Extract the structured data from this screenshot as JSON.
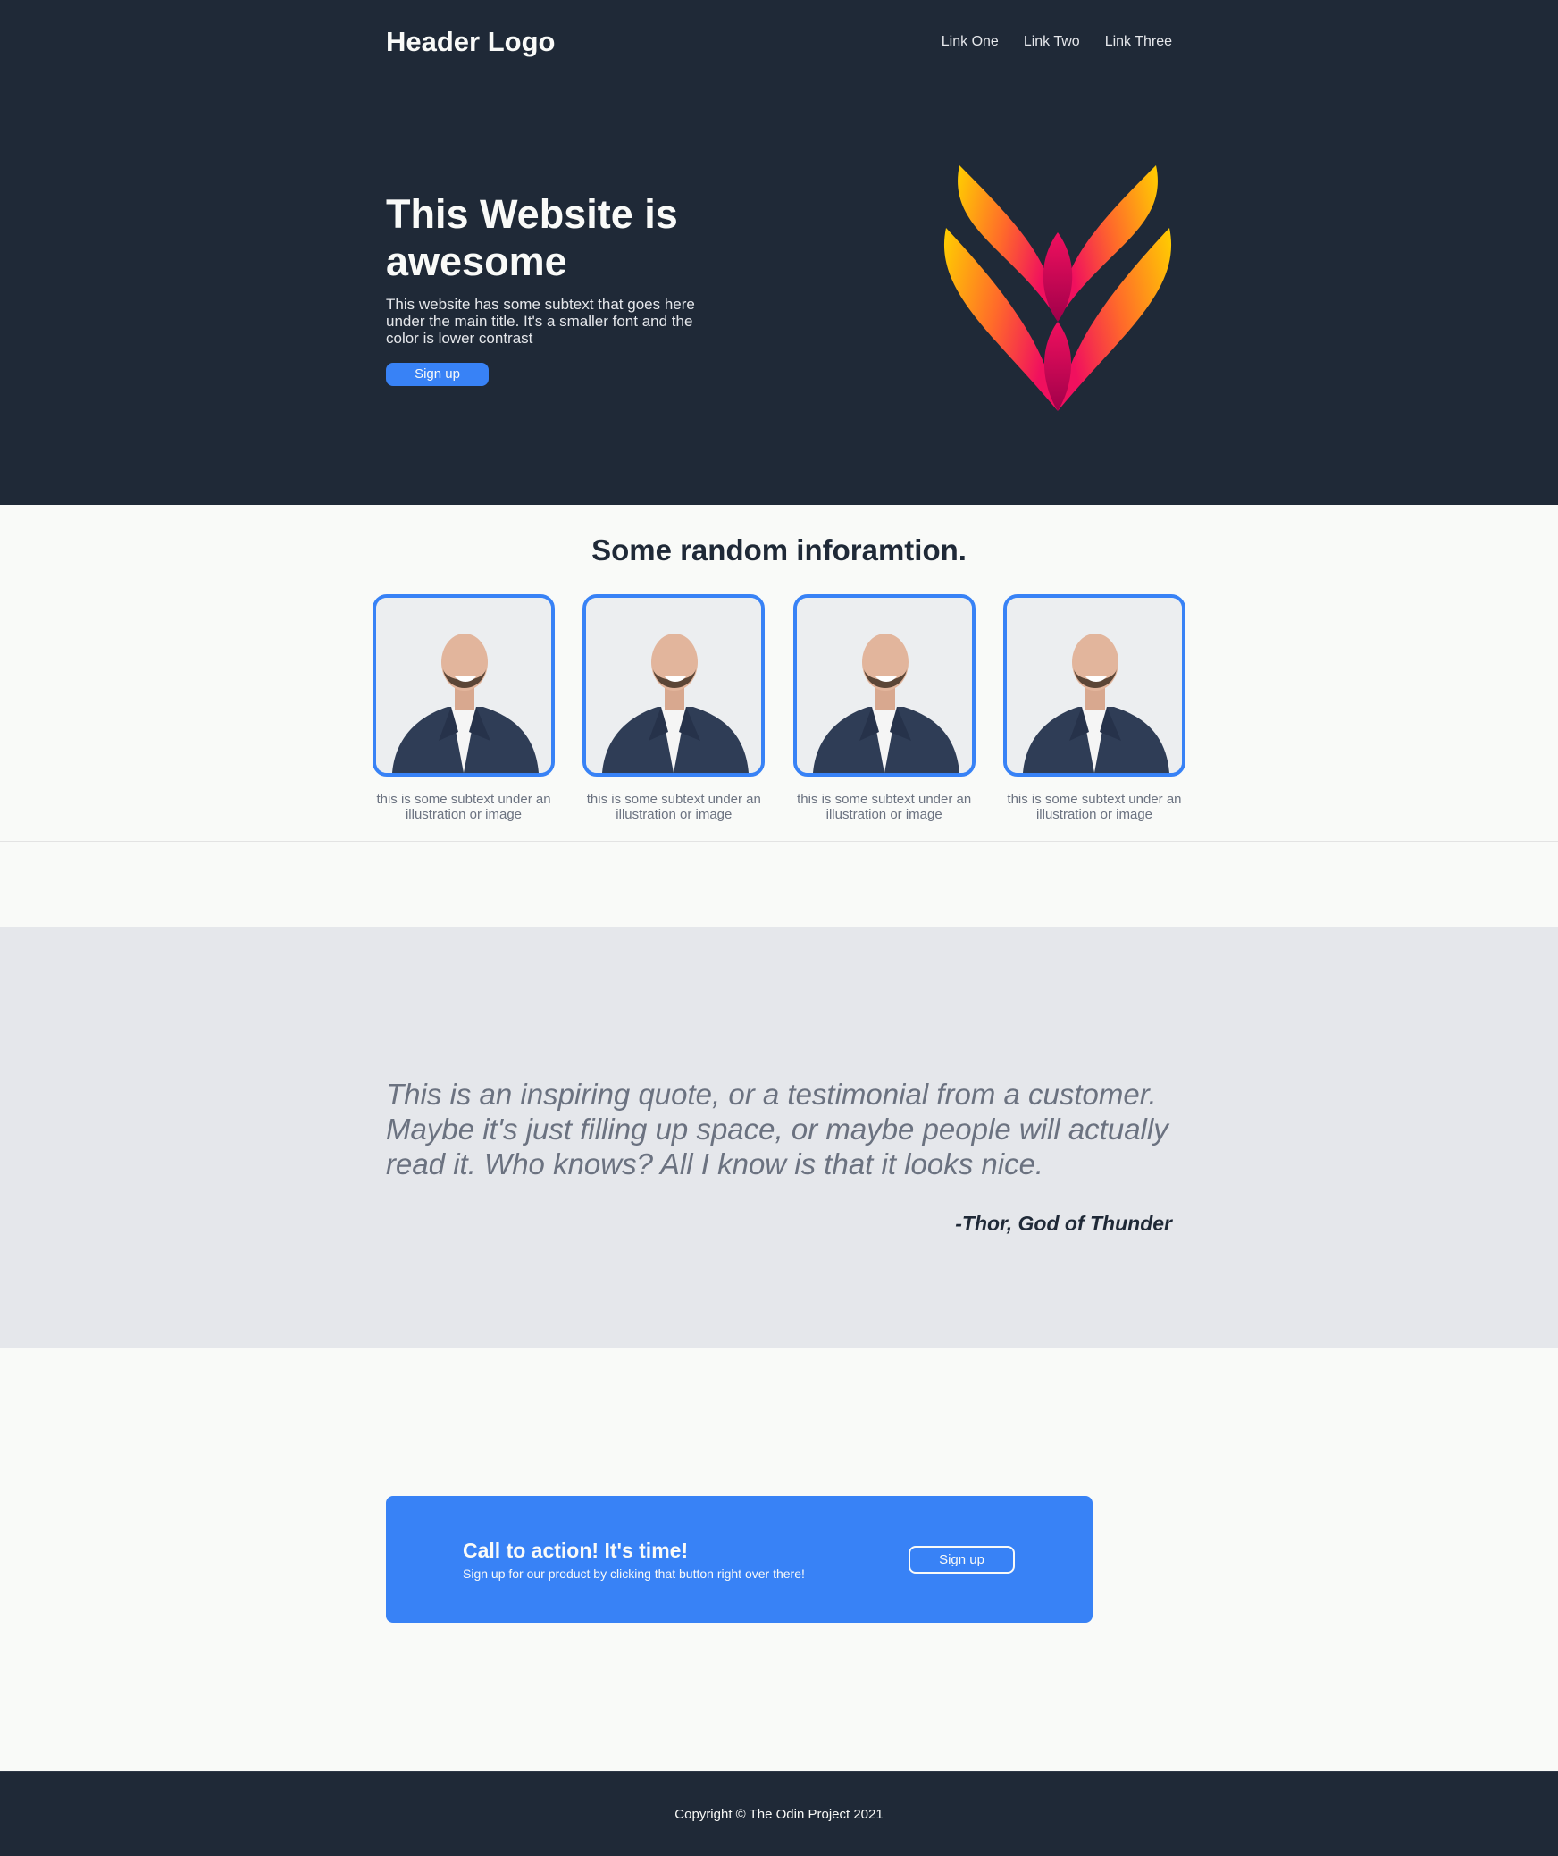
{
  "header": {
    "logo": "Header Logo",
    "links": [
      "Link One",
      "Link Two",
      "Link Three"
    ]
  },
  "hero": {
    "title": "This Website is awesome",
    "subtitle": "This website has some subtext that goes here under the main title. It's a smaller font and the color is lower contrast",
    "button_label": "Sign up",
    "art_icon": "flame-heart-logo"
  },
  "info": {
    "title": "Some random inforamtion.",
    "cards": [
      {
        "caption": "this is some subtext under an illustration or image",
        "image": "smiling-man-portrait"
      },
      {
        "caption": "this is some subtext under an illustration or image",
        "image": "smiling-man-portrait"
      },
      {
        "caption": "this is some subtext under an illustration or image",
        "image": "smiling-man-portrait"
      },
      {
        "caption": "this is some subtext under an illustration or image",
        "image": "smiling-man-portrait"
      }
    ]
  },
  "quote": {
    "text": "This is an inspiring quote, or a testimonial from a customer. Maybe it's just filling up space, or maybe people will actually read it. Who knows? All I know is that it looks nice.",
    "author": "-Thor, God of Thunder"
  },
  "cta": {
    "title": "Call to action! It's time!",
    "subtitle": "Sign up for our product by clicking that button right over there!",
    "button_label": "Sign up"
  },
  "footer": {
    "copyright": "Copyright © The Odin Project 2021"
  },
  "colors": {
    "dark": "#1f2937",
    "accent": "#3882f6",
    "light": "#f9faf8",
    "gray": "#e5e7eb",
    "muted": "#6b7280"
  }
}
